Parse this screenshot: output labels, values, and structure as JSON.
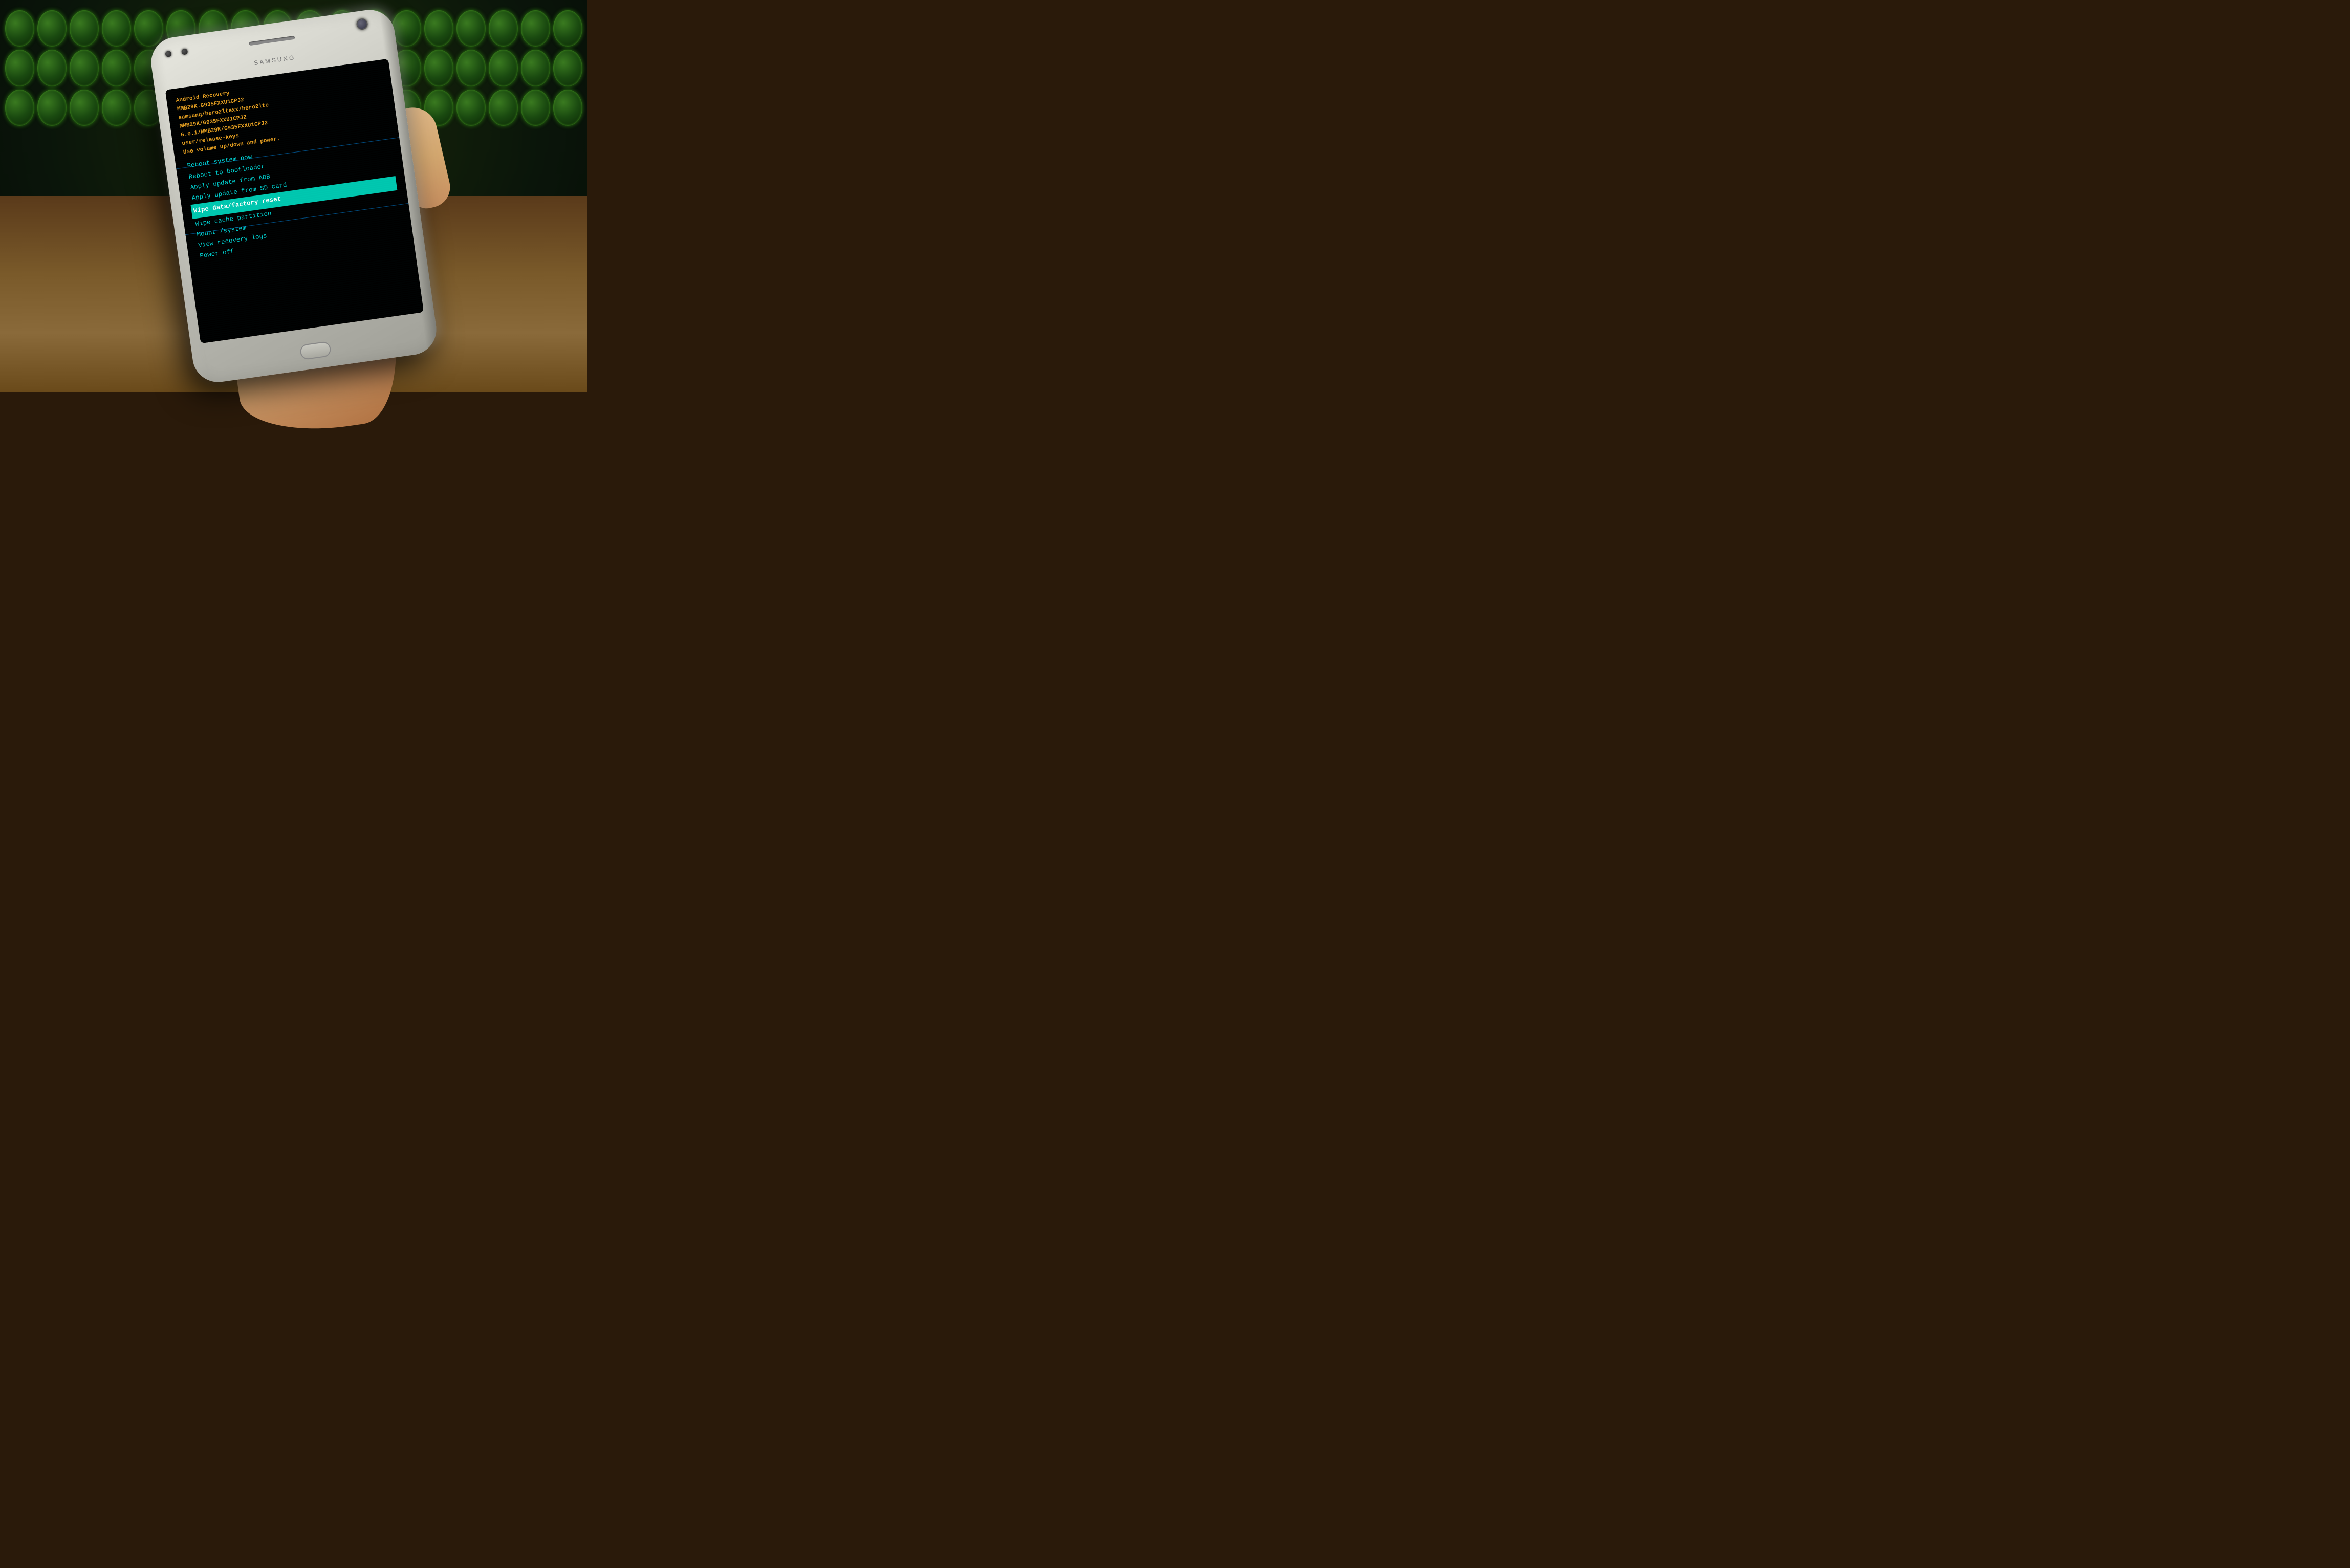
{
  "scene": {
    "phone": {
      "brand": "SAMSUNG",
      "screen": {
        "header": {
          "line1": "Android Recovery",
          "line2": "MMB29K.G935FXXU1CPJ2",
          "line3": "samsung/hero2ltexx/hero2lte",
          "line4": "MMB29K/G935FXXU1CPJ2",
          "line5": "6.0.1/MMB29K/G935FXXU1CPJ2",
          "line6": "user/release-keys",
          "line7": "Use volume up/down and power."
        },
        "menu_items": [
          {
            "id": "reboot_system",
            "label": "Reboot system now",
            "selected": false
          },
          {
            "id": "reboot_bootloader",
            "label": "Reboot to bootloader",
            "selected": false
          },
          {
            "id": "apply_adb",
            "label": "Apply update from ADB",
            "selected": false
          },
          {
            "id": "apply_sd",
            "label": "Apply update from SD card",
            "selected": false
          },
          {
            "id": "wipe_factory",
            "label": "Wipe data/factory reset",
            "selected": true
          },
          {
            "id": "wipe_cache",
            "label": "Wipe cache partition",
            "selected": false
          },
          {
            "id": "mount_system",
            "label": "Mount /system",
            "selected": false
          },
          {
            "id": "view_logs",
            "label": "View recovery logs",
            "selected": false
          },
          {
            "id": "power_off",
            "label": "Power off",
            "selected": false
          }
        ]
      }
    }
  }
}
